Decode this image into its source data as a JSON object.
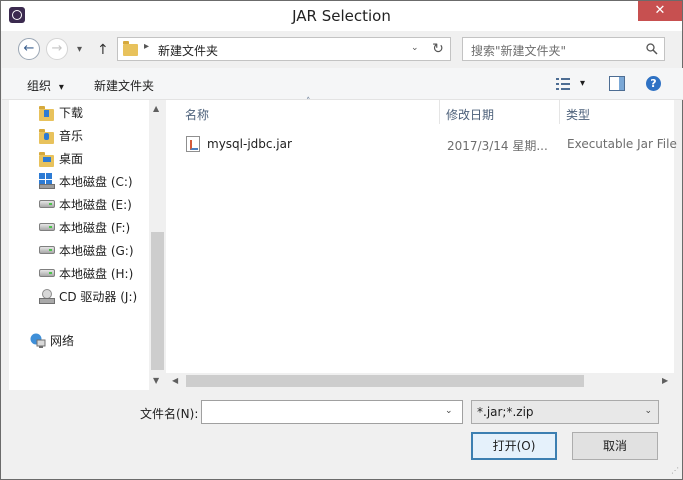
{
  "window": {
    "title": "JAR Selection",
    "close_glyph": "✕"
  },
  "nav": {
    "back_glyph": "←",
    "forward_glyph": "→",
    "recent_glyph": "▾",
    "up_glyph": "↑",
    "refresh_glyph": "↻"
  },
  "address": {
    "separator": "▸",
    "path": "新建文件夹",
    "dropdown_glyph": "⌄"
  },
  "search": {
    "placeholder": "搜索\"新建文件夹\""
  },
  "toolbar": {
    "organize_label": "组织",
    "organize_caret": "▾",
    "new_folder_label": "新建文件夹",
    "view_caret": "▾",
    "help_glyph": "?"
  },
  "sidebar": {
    "items": [
      {
        "label": "下载",
        "icon": "download-folder-icon"
      },
      {
        "label": "音乐",
        "icon": "music-folder-icon"
      },
      {
        "label": "桌面",
        "icon": "desktop-folder-icon"
      },
      {
        "label": "本地磁盘 (C:)",
        "icon": "system-drive-icon"
      },
      {
        "label": "本地磁盘 (E:)",
        "icon": "drive-icon"
      },
      {
        "label": "本地磁盘 (F:)",
        "icon": "drive-icon"
      },
      {
        "label": "本地磁盘 (G:)",
        "icon": "drive-icon"
      },
      {
        "label": "本地磁盘 (H:)",
        "icon": "drive-icon"
      },
      {
        "label": "CD 驱动器 (J:)",
        "icon": "cd-drive-icon"
      },
      {
        "label": "网络",
        "icon": "network-icon"
      }
    ]
  },
  "file_list": {
    "columns": [
      "名称",
      "修改日期",
      "类型"
    ],
    "sort_glyph": "˄",
    "rows": [
      {
        "name": "mysql-jdbc.jar",
        "modified": "2017/3/14 星期...",
        "type": "Executable Jar File"
      }
    ]
  },
  "scroll": {
    "up": "▲",
    "down": "▼",
    "left": "◀",
    "right": "▶"
  },
  "bottom": {
    "filename_label": "文件名(N):",
    "filename_value": "",
    "filename_dropdown": "⌄",
    "filter_value": "*.jar;*.zip",
    "filter_dropdown": "⌄",
    "open_label": "打开(O)",
    "cancel_label": "取消",
    "grip": "⋰"
  }
}
